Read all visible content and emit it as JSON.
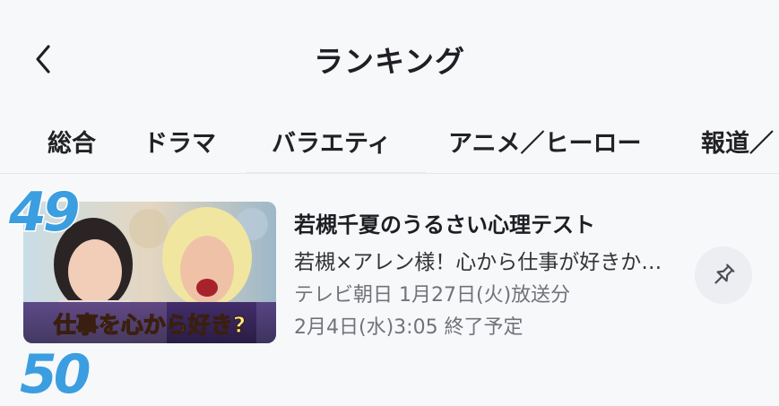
{
  "header": {
    "title": "ランキング"
  },
  "tabs": [
    {
      "label": "総合"
    },
    {
      "label": "ドラマ"
    },
    {
      "label": "バラエティ"
    },
    {
      "label": "アニメ／ヒーロー"
    },
    {
      "label": "報道／"
    }
  ],
  "ranking_item": {
    "rank": "49",
    "program_title": "若槻千夏のうるさい心理テスト",
    "episode_description": "若槻×アレン様！心から仕事が好きか…",
    "broadcast_info": "テレビ朝日 1月27日(火)放送分",
    "availability": "2月4日(水)3:05 終了予定",
    "thumbnail_caption": "仕事を心から好き?"
  },
  "next_item": {
    "rank": "50"
  },
  "icons": {
    "back": "chevron-left-icon",
    "pin": "pin-icon"
  },
  "colors": {
    "rank": "#3b9ee0",
    "background": "#f7f8fa",
    "pin_button_bg": "#eceef2"
  }
}
